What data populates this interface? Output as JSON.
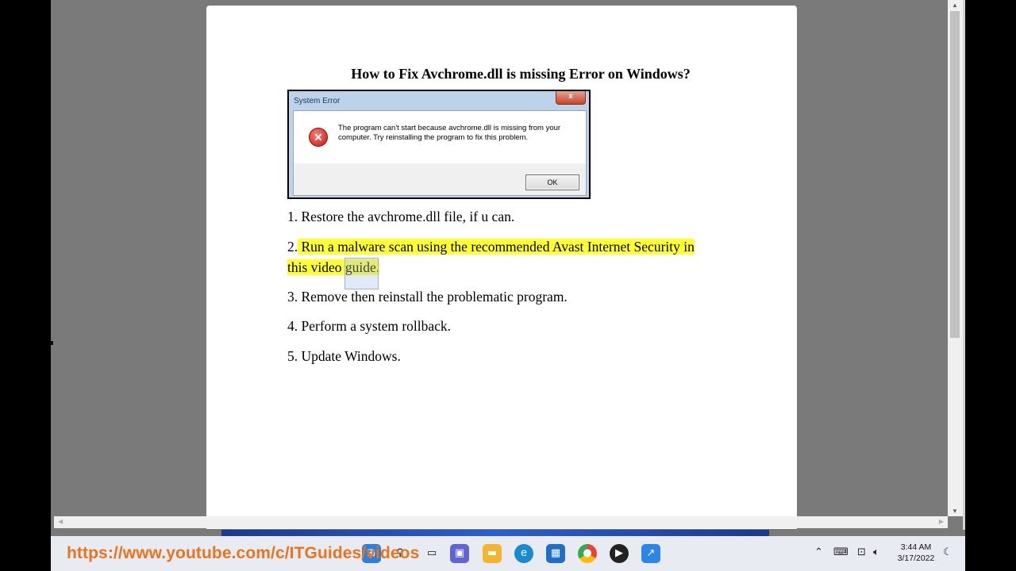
{
  "document": {
    "title": "How to Fix Avchrome.dll is missing Error on Windows?",
    "error_dialog": {
      "title": "System Error",
      "close_glyph": "x",
      "message": "The program can't start because avchrome.dll is missing from your computer. Try reinstalling the program to fix this problem.",
      "ok_label": "OK"
    },
    "steps": [
      {
        "num": "1.",
        "text": "Restore the avchrome.dll file, if u can."
      },
      {
        "num": "2.",
        "line1": "Run a malware scan using the recommended Avast Internet Security in",
        "line2_a": "this video ",
        "line2_b": "guide",
        "line2_c": "."
      },
      {
        "num": "3.",
        "text": "Remove then reinstall the problematic program."
      },
      {
        "num": "4.",
        "text": "Perform a system rollback."
      },
      {
        "num": "5.",
        "text": "Update Windows."
      }
    ]
  },
  "overlay": {
    "url": "https://www.youtube.com/c/ITGuides/videos"
  },
  "taskbar": {
    "apps": [
      "start-icon",
      "search-icon",
      "chat-icon",
      "file-explorer-icon",
      "edge-icon",
      "store-icon",
      "chrome-icon",
      "media-player-icon",
      "app-icon"
    ],
    "clock_time": "3:44 AM",
    "clock_date": "3/17/2022"
  },
  "colors": {
    "highlight": "#ffff33",
    "overlay_text": "#e8741c"
  }
}
